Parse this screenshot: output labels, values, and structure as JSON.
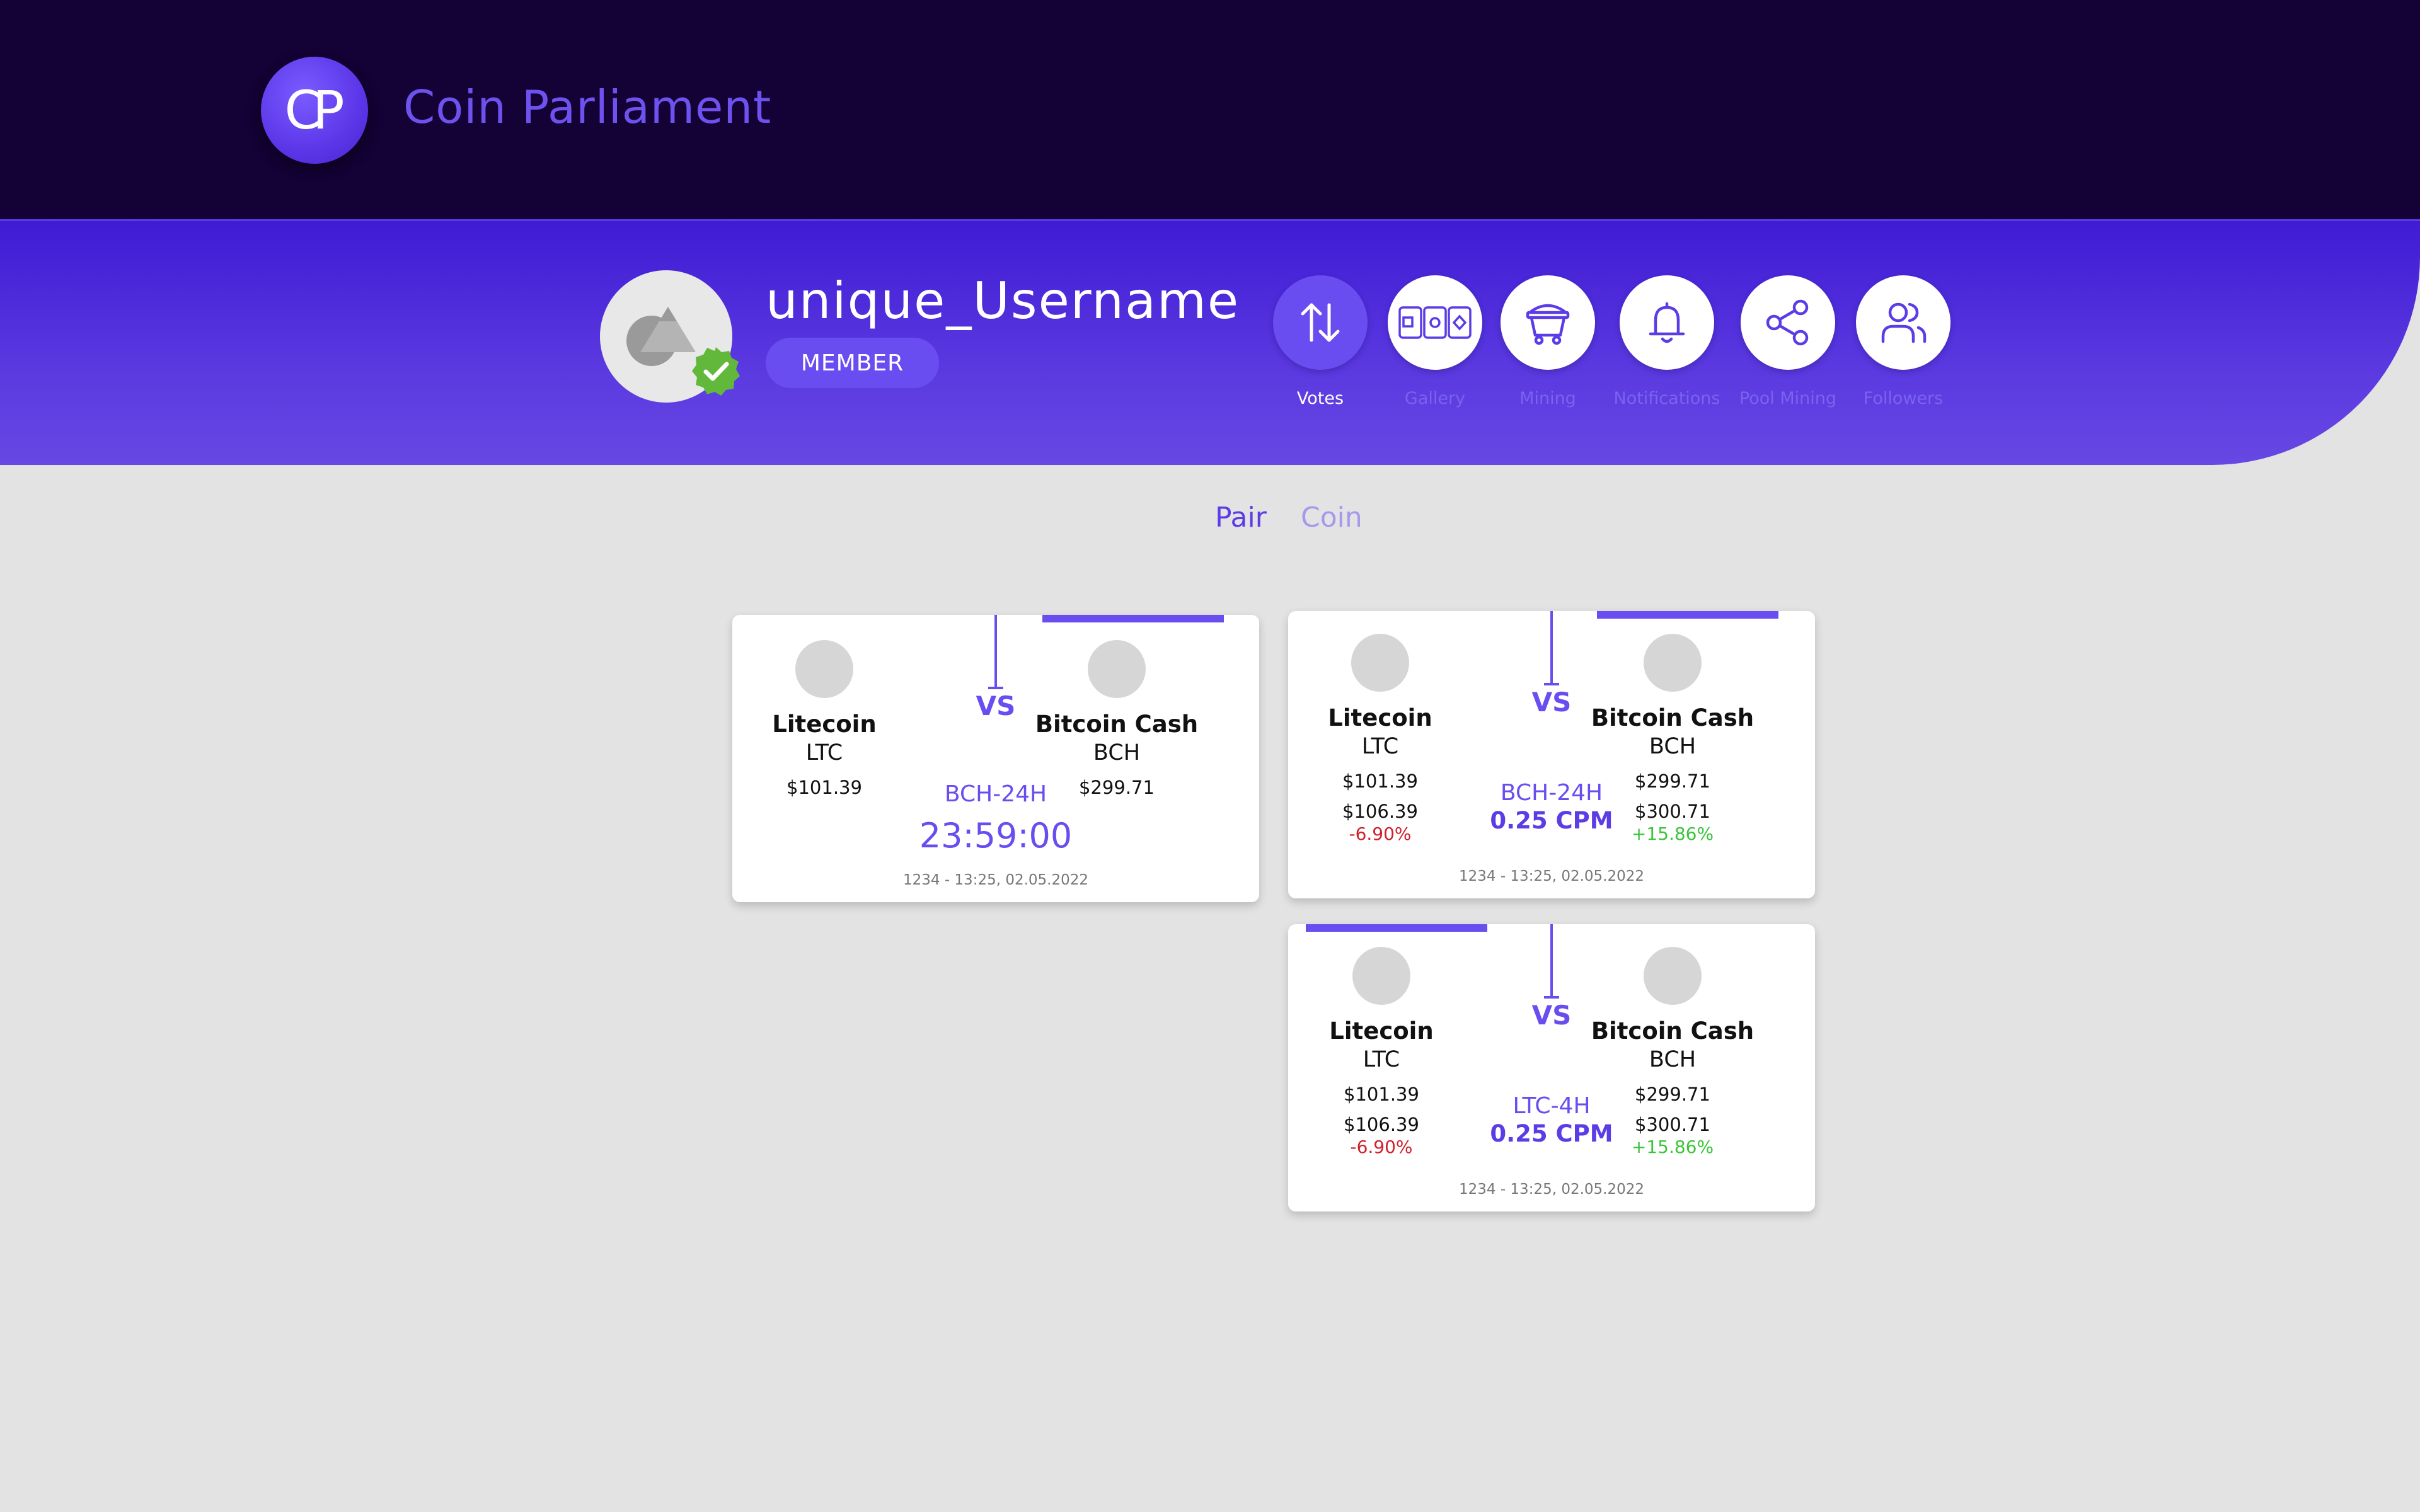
{
  "header": {
    "logo_text": "CP",
    "brand": "Coin Parliament"
  },
  "profile": {
    "username": "unique_Username",
    "badge": "MEMBER",
    "actions": [
      {
        "label": "Votes",
        "icon": "votes-arrows-icon",
        "active": true
      },
      {
        "label": "Gallery",
        "icon": "gallery-cards-icon",
        "active": false
      },
      {
        "label": "Mining",
        "icon": "mining-cart-icon",
        "active": false
      },
      {
        "label": "Notifications",
        "icon": "bell-icon",
        "active": false
      },
      {
        "label": "Pool Mining",
        "icon": "share-icon",
        "active": false
      },
      {
        "label": "Followers",
        "icon": "followers-icon",
        "active": false
      }
    ]
  },
  "tabs": {
    "pair": "Pair",
    "coin": "Coin",
    "selected": "Pair"
  },
  "vs_label": "VS",
  "cards": [
    {
      "left": {
        "name": "Litecoin",
        "symbol": "LTC",
        "price": "$101.39"
      },
      "right": {
        "name": "Bitcoin Cash",
        "symbol": "BCH",
        "price": "$299.71"
      },
      "pair_label": "BCH-24H",
      "timer": "23:59:00",
      "footer": "1234 - 13:25, 02.05.2022"
    },
    {
      "left": {
        "name": "Litecoin",
        "symbol": "LTC",
        "price": "$101.39",
        "current": "$106.39",
        "change": "-6.90%"
      },
      "right": {
        "name": "Bitcoin Cash",
        "symbol": "BCH",
        "price": "$299.71",
        "current": "$300.71",
        "change": "+15.86%"
      },
      "pair_label": "BCH-24H",
      "cpm": "0.25 CPM",
      "footer": "1234 - 13:25, 02.05.2022"
    },
    {
      "left": {
        "name": "Litecoin",
        "symbol": "LTC",
        "price": "$101.39",
        "current": "$106.39",
        "change": "-6.90%"
      },
      "right": {
        "name": "Bitcoin Cash",
        "symbol": "BCH",
        "price": "$299.71",
        "current": "$300.71",
        "change": "+15.86%"
      },
      "pair_label": "LTC-4H",
      "cpm": "0.25 CPM",
      "footer": "1234 - 13:25, 02.05.2022"
    }
  ],
  "colors": {
    "topbar": "#140135",
    "accent": "#6a4df0",
    "negative": "#d0202a",
    "positive": "#3cc43c"
  }
}
